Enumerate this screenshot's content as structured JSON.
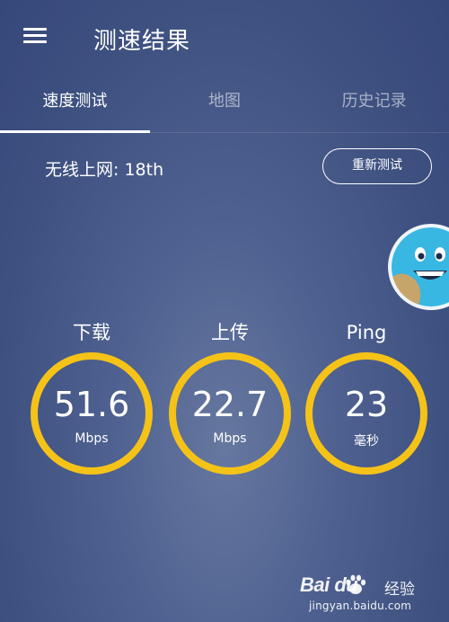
{
  "header": {
    "title": "测速结果",
    "menu_icon": "hamburger-menu-icon"
  },
  "tabs": [
    {
      "label": "速度测试",
      "active": true
    },
    {
      "label": "地图",
      "active": false
    },
    {
      "label": "历史记录",
      "active": false
    }
  ],
  "network": {
    "label": "无线上网: 18th"
  },
  "retest_button": {
    "label": "重新测试"
  },
  "mascot": {
    "icon": "smiling-globe-mascot-icon"
  },
  "stats": {
    "download": {
      "label": "下载",
      "value": "51.6",
      "unit": "Mbps"
    },
    "upload": {
      "label": "上传",
      "value": "22.7",
      "unit": "Mbps"
    },
    "ping": {
      "label": "Ping",
      "value": "23",
      "unit": "毫秒"
    }
  },
  "watermark": {
    "logo": "Bai  du",
    "name": "经验",
    "url": "jingyan.baidu.com"
  },
  "colors": {
    "background": "#3d4f7d",
    "ring": "#f5c318",
    "text": "#ffffff"
  }
}
